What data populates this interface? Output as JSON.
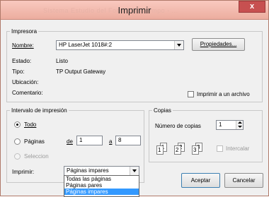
{
  "window": {
    "title": "Imprimir",
    "ghost_title": "Sistema  Estudio  del  Fondo  del  Tiempo  -  ...",
    "close_symbol": "x"
  },
  "printer": {
    "group_label": "Impresora",
    "name_label": "Nombre:",
    "name_value": "HP LaserJet 1018#:2",
    "properties_button": "Propiedades...",
    "status_label": "Estado:",
    "status_value": "Listo",
    "type_label": "Tipo:",
    "type_value": "TP Output Gateway",
    "location_label": "Ubicación:",
    "location_value": "",
    "comment_label": "Comentario:",
    "comment_value": "",
    "print_to_file_label": "Imprimir a un archivo"
  },
  "range": {
    "group_label": "Intervalo de impresión",
    "all_label": "Todo",
    "pages_label": "Páginas",
    "from_label": "de",
    "from_value": "1",
    "to_label": "a",
    "to_value": "8",
    "selection_label": "Seleccion"
  },
  "print_what": {
    "label": "Imprimir:",
    "selected": "Páginas impares",
    "options": [
      "Todas las páginas",
      "Páginas pares",
      "Páginas impares"
    ]
  },
  "copies": {
    "group_label": "Copias",
    "number_label": "Número de copias",
    "number_value": "1",
    "collate_label": "Intercalar",
    "collate_pages": [
      {
        "back": "1",
        "front": "1"
      },
      {
        "back": "2",
        "front": "2"
      },
      {
        "back": "3",
        "front": "3"
      }
    ]
  },
  "buttons": {
    "accept": "Aceptar",
    "cancel": "Cancelar"
  }
}
